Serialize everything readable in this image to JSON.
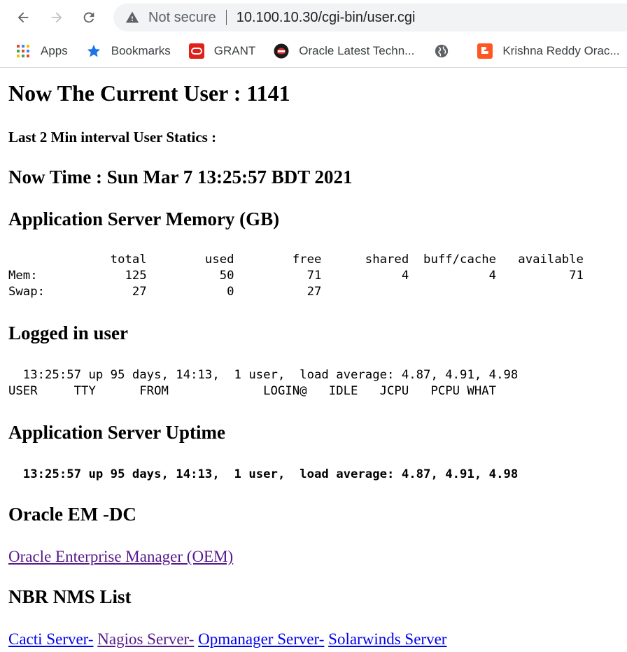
{
  "browser": {
    "security_label": "Not secure",
    "url": "10.100.10.30/cgi-bin/user.cgi",
    "bookmarks": [
      {
        "label": "Apps",
        "icon": "apps-grid-icon"
      },
      {
        "label": "Bookmarks",
        "icon": "star-icon"
      },
      {
        "label": "GRANT",
        "icon": "oracle-logo-icon"
      },
      {
        "label": "Oracle Latest Techn...",
        "icon": "oracle-helmet-icon"
      },
      {
        "label": "",
        "icon": "globe-icon"
      },
      {
        "label": "Krishna Reddy Orac...",
        "icon": "blogger-icon"
      }
    ],
    "colors": {
      "omnibox_bg": "#f1f3f4",
      "link_visited": "#551a8b",
      "link_unvisited": "#0000ee"
    }
  },
  "page": {
    "current_user_title": "Now The Current User : 1141",
    "interval_stat_heading": "Last 2 Min interval User Statics :",
    "now_time_heading": "Now Time : Sun Mar 7 13:25:57 BDT 2021",
    "memory_heading": "Application Server Memory (GB)",
    "memory_output": "              total        used        free      shared  buff/cache   available\nMem:            125          50          71           4           4          71\nSwap:            27           0          27",
    "logged_heading": "Logged in user",
    "logged_output": "  13:25:57 up 95 days, 14:13,  1 user,  load average: 4.87, 4.91, 4.98\nUSER     TTY      FROM             LOGIN@   IDLE   JCPU   PCPU WHAT",
    "uptime_heading": "Application Server Uptime",
    "uptime_output": "  13:25:57 up 95 days, 14:13,  1 user,  load average: 4.87, 4.91, 4.98",
    "oem_heading": "Oracle EM -DC",
    "oem_link": "Oracle Enterprise Manager (OEM)",
    "nms_heading": "NBR NMS List",
    "nms_links": {
      "cacti": "Cacti Server-",
      "nagios": "Nagios Server-",
      "opmanager": "Opmanager Server-",
      "solarwinds": "Solarwinds Server"
    }
  }
}
